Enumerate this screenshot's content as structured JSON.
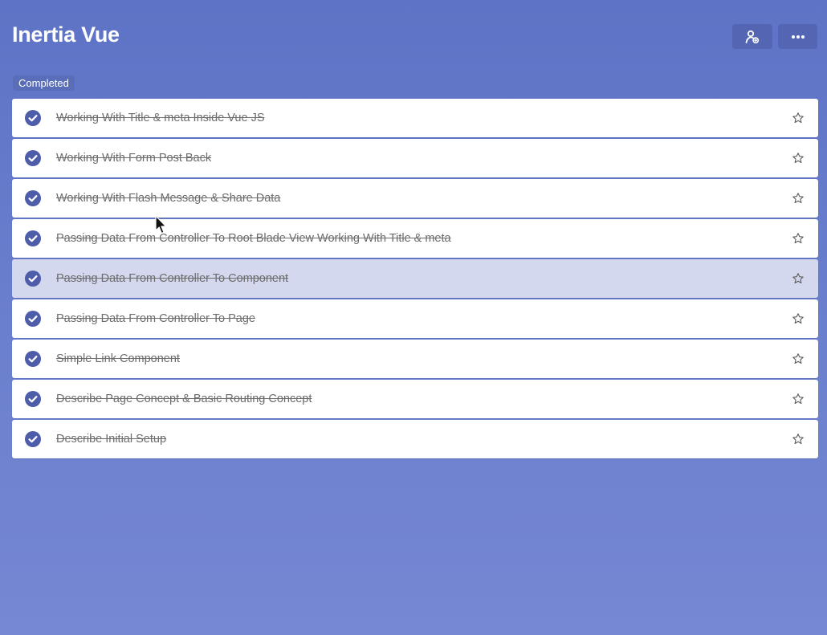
{
  "app": {
    "title": "Inertia Vue"
  },
  "header": {
    "share_icon": "person-share-icon",
    "more_icon": "ellipsis-icon"
  },
  "section": {
    "label": "Completed"
  },
  "colors": {
    "accent": "#5466b3",
    "check": "#4d5daa",
    "selected_row": "#d3d8ef"
  },
  "tasks": [
    {
      "title": "Working With Title & meta Inside Vue JS",
      "completed": true,
      "starred": false
    },
    {
      "title": "Working With Form Post Back",
      "completed": true,
      "starred": false
    },
    {
      "title": "Working With Flash Message & Share Data",
      "completed": true,
      "starred": false
    },
    {
      "title": "Passing Data From Controller To Root Blade View Working With Title & meta",
      "completed": true,
      "starred": false
    },
    {
      "title": "Passing Data From Controller To Component",
      "completed": true,
      "starred": false,
      "selected": true
    },
    {
      "title": "Passing Data From Controller To Page",
      "completed": true,
      "starred": false
    },
    {
      "title": "Simple Link Component",
      "completed": true,
      "starred": false
    },
    {
      "title": "Describe Page Concept & Basic Routing Concept",
      "completed": true,
      "starred": false
    },
    {
      "title": "Describe Initial Setup",
      "completed": true,
      "starred": false
    }
  ]
}
